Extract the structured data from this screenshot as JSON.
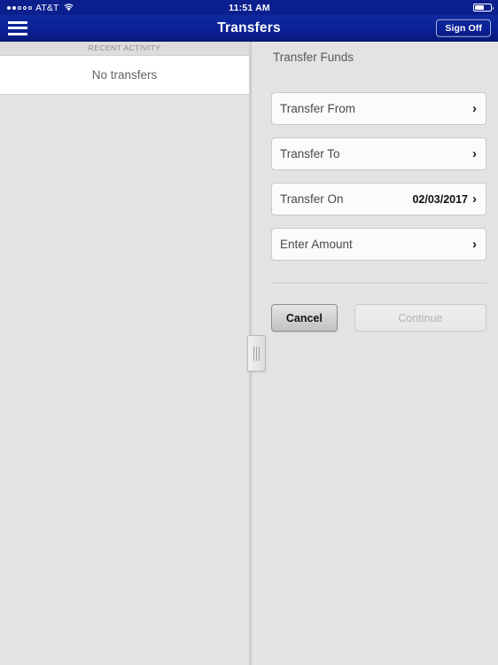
{
  "status_bar": {
    "carrier": "AT&T",
    "signal_dots_filled": 2,
    "signal_dots_total": 5,
    "wifi_icon": "wifi-icon",
    "time": "11:51 AM",
    "battery_icon": "battery-icon"
  },
  "nav_bar": {
    "menu_icon": "hamburger-menu-icon",
    "title": "Transfers",
    "sign_off_label": "Sign Off",
    "background_color": "#0b2196"
  },
  "left_panel": {
    "section_header": "RECENT ACTIVITY",
    "empty_message": "No transfers"
  },
  "divider": {
    "handle_icon": "drag-handle-icon"
  },
  "right_panel": {
    "title": "Transfer Funds",
    "form_rows": [
      {
        "label": "Transfer From",
        "value": "",
        "chevron": "›"
      },
      {
        "label": "Transfer To",
        "value": "",
        "chevron": "›"
      },
      {
        "label": "Transfer On",
        "value": "02/03/2017",
        "chevron": "›"
      },
      {
        "label": "Enter Amount",
        "value": "",
        "chevron": "›"
      }
    ],
    "buttons": {
      "cancel_label": "Cancel",
      "continue_label": "Continue"
    }
  }
}
